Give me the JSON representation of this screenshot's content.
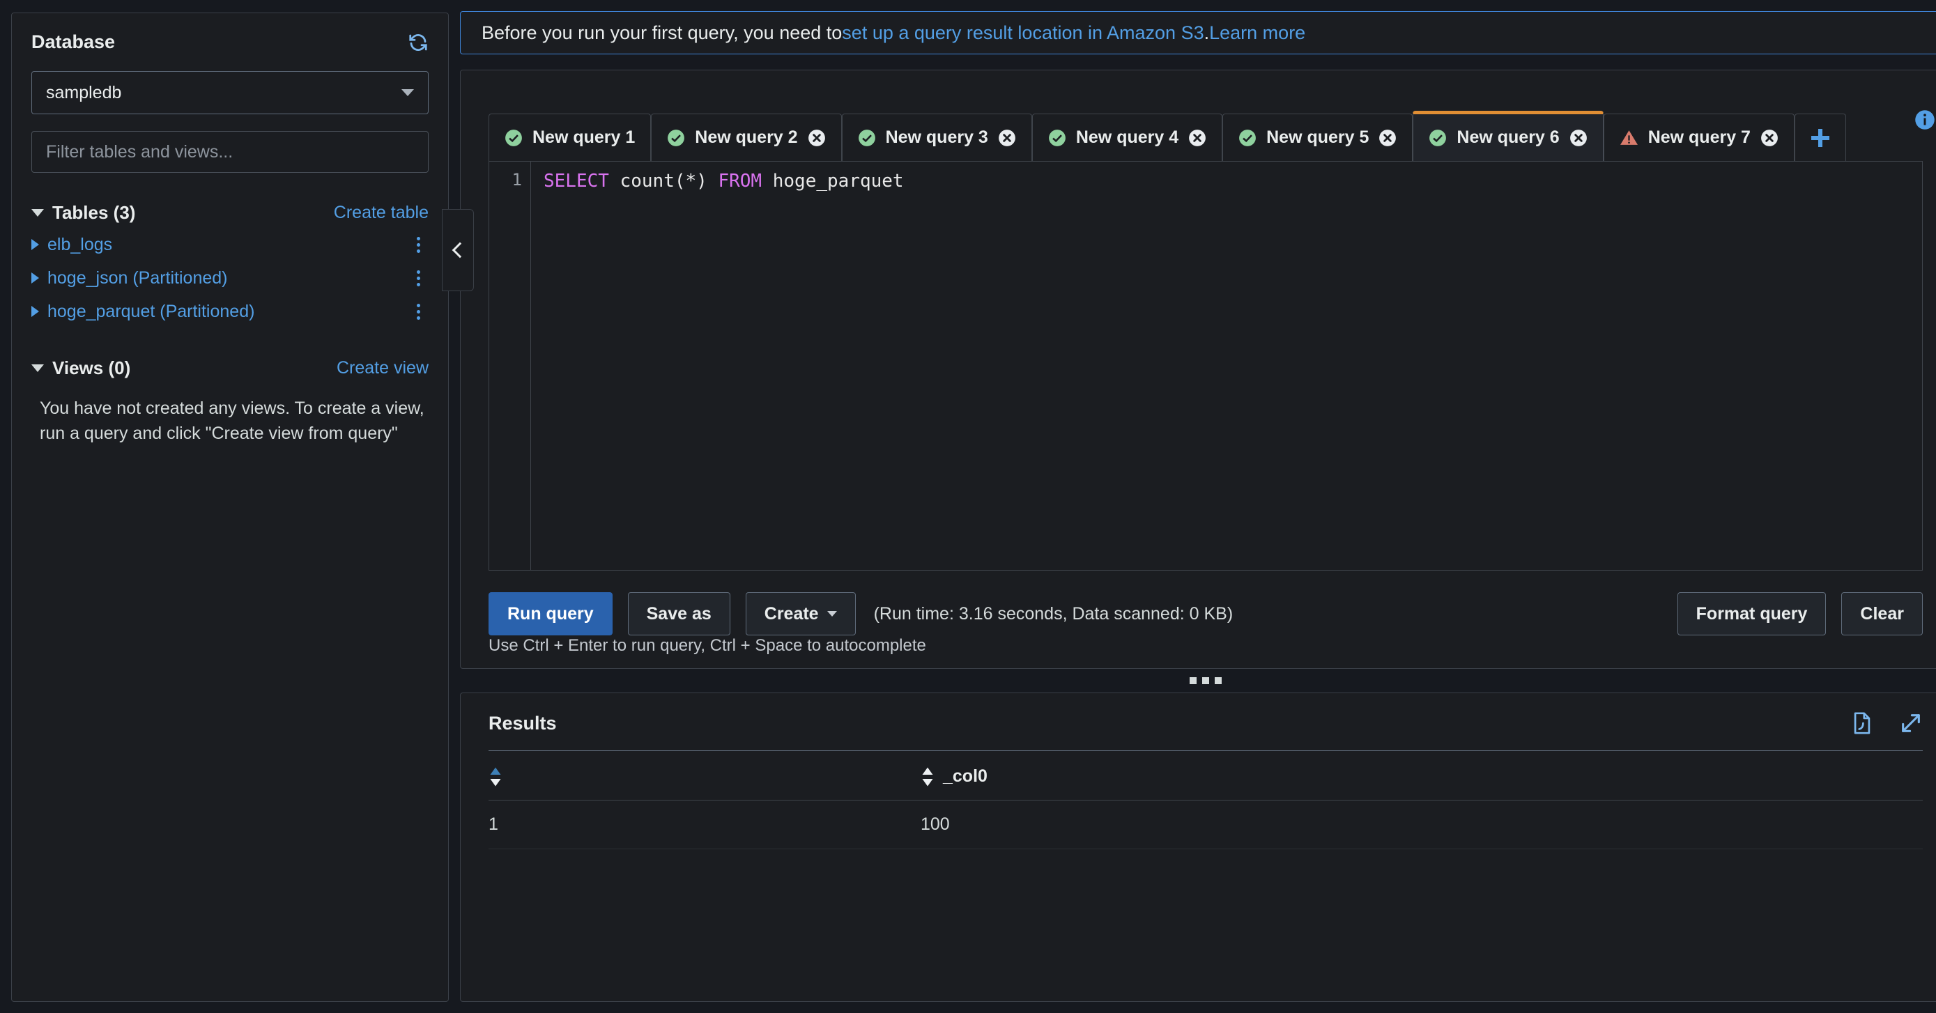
{
  "sidebar": {
    "title": "Database",
    "refresh_icon": "refresh-icon",
    "database": {
      "selected": "sampledb"
    },
    "filter": {
      "placeholder": "Filter tables and views...",
      "value": ""
    },
    "tables_section": {
      "title": "Tables (3)",
      "action_label": "Create table",
      "items": [
        {
          "name": "elb_logs"
        },
        {
          "name": "hoge_json (Partitioned)"
        },
        {
          "name": "hoge_parquet (Partitioned)"
        }
      ]
    },
    "views_section": {
      "title": "Views (0)",
      "action_label": "Create view",
      "empty_text": "You have not created any views. To create a view, run a query and click \"Create view from query\""
    }
  },
  "banner": {
    "text_before": "Before you run your first query, you need to ",
    "link_text": "set up a query result location in Amazon S3",
    "text_middle": ". ",
    "link_text2": "Learn more"
  },
  "editor": {
    "info_icon": "info-icon",
    "add_tab_icon": "plus-icon",
    "tabs": [
      {
        "label": "New query 1",
        "status": "ok",
        "closable": false,
        "active": false
      },
      {
        "label": "New query 2",
        "status": "ok",
        "closable": true,
        "active": false
      },
      {
        "label": "New query 3",
        "status": "ok",
        "closable": true,
        "active": false
      },
      {
        "label": "New query 4",
        "status": "ok",
        "closable": true,
        "active": false
      },
      {
        "label": "New query 5",
        "status": "ok",
        "closable": true,
        "active": false
      },
      {
        "label": "New query 6",
        "status": "ok",
        "closable": true,
        "active": true
      },
      {
        "label": "New query 7",
        "status": "warning",
        "closable": true,
        "active": false
      }
    ],
    "line_number": "1",
    "sql": "SELECT count(*) FROM hoge_parquet",
    "sql_tokens": [
      {
        "t": "SELECT",
        "kw": true
      },
      {
        "t": " count(*) ",
        "kw": false
      },
      {
        "t": "FROM",
        "kw": true
      },
      {
        "t": " hoge_parquet",
        "kw": false
      }
    ],
    "buttons": {
      "run": "Run query",
      "save_as": "Save as",
      "create": "Create",
      "format": "Format query",
      "clear": "Clear"
    },
    "stats": "(Run time: 3.16 seconds, Data scanned: 0 KB)",
    "hint": "Use Ctrl + Enter to run query, Ctrl + Space to autocomplete"
  },
  "results": {
    "title": "Results",
    "download_icon": "download-file-icon",
    "expand_icon": "expand-icon",
    "columns": [
      {
        "label": "",
        "sort": "asc"
      },
      {
        "label": "_col0",
        "sort": "none"
      }
    ],
    "rows": [
      {
        "index": "1",
        "col0": "100"
      }
    ]
  },
  "colors": {
    "accent_blue": "#539fe5",
    "primary_button": "#2a62ad",
    "active_tab_border": "#e08e34",
    "status_ok": "#8fd19e",
    "status_warning": "#d97b6c",
    "sql_keyword": "#d973ef",
    "page_bg": "#16191f",
    "panel_bg": "#1b1d21"
  }
}
